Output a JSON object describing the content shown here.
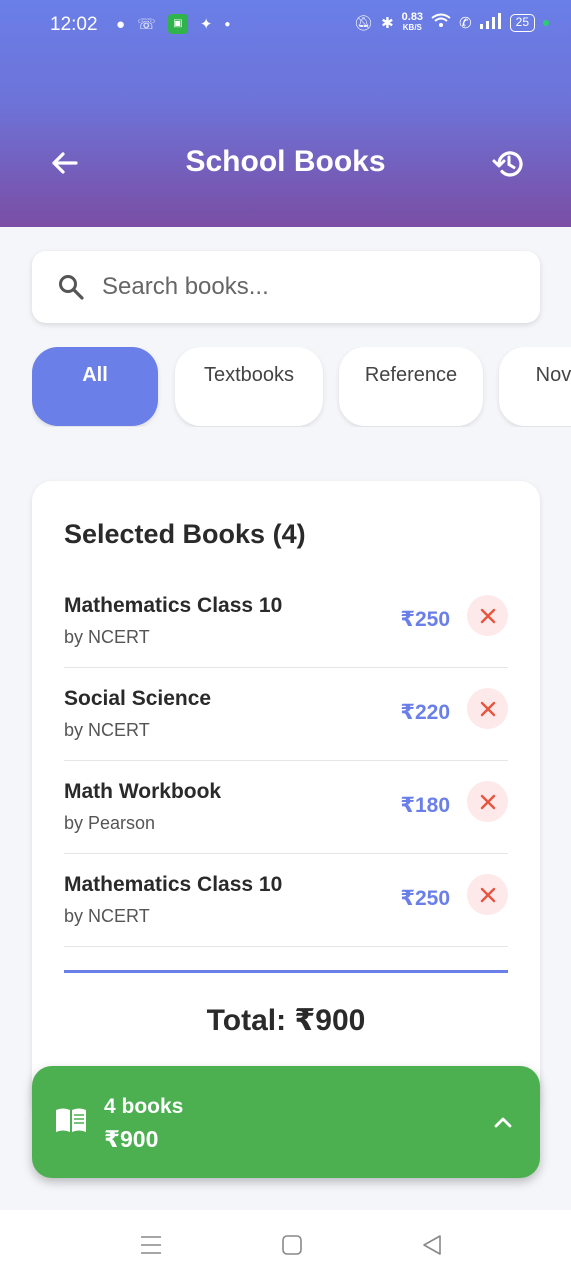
{
  "status_bar": {
    "time": "12:02",
    "net_speed_value": "0.83",
    "net_speed_unit": "KB/S",
    "battery": "25"
  },
  "header": {
    "title": "School Books"
  },
  "search": {
    "placeholder": "Search books..."
  },
  "categories": [
    {
      "label": "All",
      "active": true
    },
    {
      "label": "Textbooks",
      "active": false
    },
    {
      "label": "Reference",
      "active": false
    },
    {
      "label": "Nove",
      "active": false
    }
  ],
  "selected": {
    "title": "Selected Books (4)",
    "items": [
      {
        "name": "Mathematics Class 10",
        "author": "by NCERT",
        "price": "₹250"
      },
      {
        "name": "Social Science",
        "author": "by NCERT",
        "price": "₹220"
      },
      {
        "name": "Math Workbook",
        "author": "by Pearson",
        "price": "₹180"
      },
      {
        "name": "Mathematics Class 10",
        "author": "by NCERT",
        "price": "₹250"
      }
    ],
    "total": "Total: ₹900"
  },
  "cart": {
    "count": "4 books",
    "total": "₹900"
  },
  "colors": {
    "accent": "#6a7fe8",
    "header_bottom": "#7a4ea4",
    "cart_green": "#4caf50",
    "remove_red": "#e8553f"
  },
  "icons": [
    "back-arrow-icon",
    "history-icon",
    "search-icon",
    "close-icon",
    "book-icon",
    "chevron-up-icon"
  ]
}
